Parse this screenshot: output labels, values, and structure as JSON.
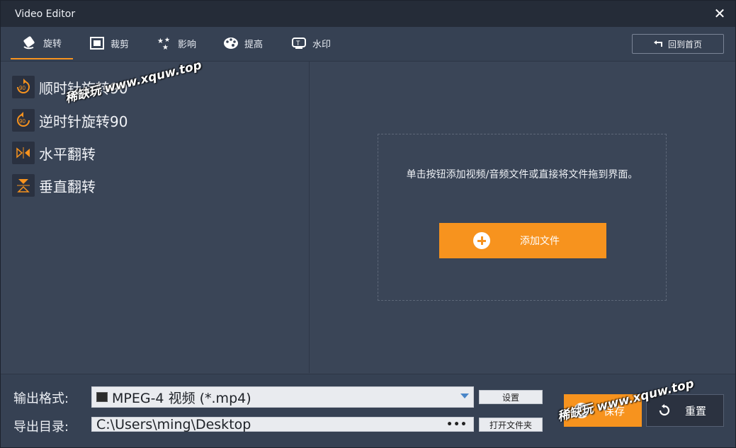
{
  "window": {
    "title": "Video Editor",
    "close_glyph": "✕"
  },
  "tabs": [
    {
      "label": "旋转",
      "icon": "rotate-icon",
      "active": true
    },
    {
      "label": "裁剪",
      "icon": "crop-icon",
      "active": false
    },
    {
      "label": "影响",
      "icon": "effects-stars-icon",
      "active": false
    },
    {
      "label": "提高",
      "icon": "palette-icon",
      "active": false
    },
    {
      "label": "水印",
      "icon": "watermark-icon",
      "active": false
    }
  ],
  "home_button": {
    "label": "回到首页",
    "icon": "return-arrow-icon"
  },
  "operations": [
    {
      "label": "顺时针旋转90",
      "icon": "rotate-clockwise-90-icon"
    },
    {
      "label": "逆时针旋转90",
      "icon": "rotate-counterclockwise-90-icon"
    },
    {
      "label": "水平翻转",
      "icon": "flip-horizontal-icon"
    },
    {
      "label": "垂直翻转",
      "icon": "flip-vertical-icon"
    }
  ],
  "dropzone": {
    "message": "单击按钮添加视频/音频文件或直接将文件拖到界面。",
    "add_button": "添加文件"
  },
  "output": {
    "format_label": "输出格式:",
    "format_value": "MPEG-4 视频 (*.mp4)",
    "settings_button": "设置",
    "dir_label": "导出目录:",
    "dir_value": "C:\\Users\\ming\\Desktop",
    "dir_more": "•••",
    "open_folder_button": "打开文件夹"
  },
  "actions": {
    "save": "保存",
    "reset": "重置"
  },
  "watermark": {
    "text": "稀缺玩 www.xquw.top"
  },
  "colors": {
    "accent": "#f7931e",
    "background": "#3a4557",
    "titlebar": "#252c38"
  }
}
